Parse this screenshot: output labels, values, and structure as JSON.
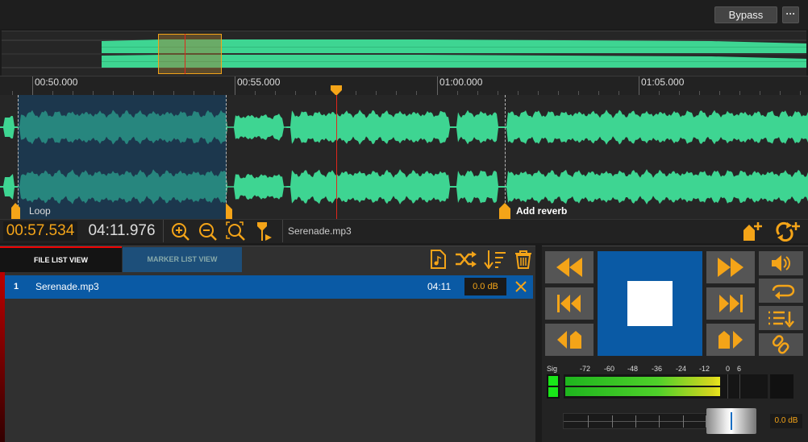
{
  "toolbar": {
    "bypass_label": "Bypass",
    "more_label": "···"
  },
  "ruler": {
    "labels": [
      "00:50.000",
      "00:55.000",
      "01:00.000",
      "01:05.000"
    ]
  },
  "markers": {
    "loop_label": "Loop",
    "reverb_label": "Add reverb"
  },
  "transport_bar": {
    "current_time": "00:57.534",
    "total_time": "04:11.976",
    "file_name": "Serenade.mp3"
  },
  "tabs": {
    "file_list": "FILE LIST VIEW",
    "marker_list": "MARKER LIST VIEW"
  },
  "file_list": [
    {
      "index": "1",
      "name": "Serenade.mp3",
      "duration": "04:11",
      "gain": "0.0 dB"
    }
  ],
  "meter": {
    "sig_label": "Sig",
    "scale": [
      "-72",
      "-60",
      "-48",
      "-36",
      "-24",
      "-12",
      "0",
      "6"
    ]
  },
  "volume": {
    "value": "0.0 dB"
  },
  "colors": {
    "accent": "#f4a418",
    "waveform": "#3ed592",
    "selection": "#0a5aa5",
    "playhead": "#e0261b"
  }
}
